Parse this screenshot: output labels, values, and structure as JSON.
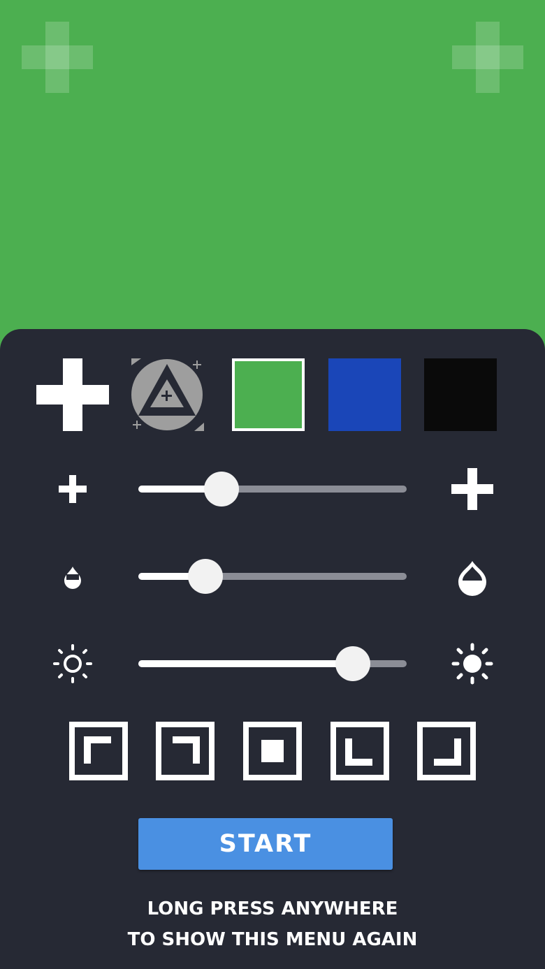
{
  "colors": {
    "background": "#4CAF50",
    "panel": "#262934",
    "accent": "#4A90E2",
    "track": "#8b8d96"
  },
  "background_icons": [
    "plus-icon",
    "plus-icon"
  ],
  "crosshair_options": [
    {
      "id": "plain-cross",
      "icon": "plus-icon",
      "selected": true
    },
    {
      "id": "triangle-circle",
      "icon": "triangle-circle-icon",
      "selected": false
    }
  ],
  "color_swatches": [
    {
      "color": "#4CAF50",
      "selected": true
    },
    {
      "color": "#1A46B8",
      "selected": false
    },
    {
      "color": "#0A0A0A",
      "selected": false
    }
  ],
  "sliders": [
    {
      "id": "size",
      "min_icon": "plus-small-icon",
      "max_icon": "plus-large-icon",
      "value": 0.31
    },
    {
      "id": "opacity",
      "min_icon": "drop-small-icon",
      "max_icon": "drop-large-icon",
      "value": 0.25
    },
    {
      "id": "brightness",
      "min_icon": "sun-dim-icon",
      "max_icon": "sun-bright-icon",
      "value": 0.8
    }
  ],
  "positions": [
    {
      "id": "top-left",
      "icon": "corner-top-left-icon",
      "selected": false
    },
    {
      "id": "top-right",
      "icon": "corner-top-right-icon",
      "selected": false
    },
    {
      "id": "center",
      "icon": "center-square-icon",
      "selected": true
    },
    {
      "id": "bottom-left",
      "icon": "corner-bottom-left-icon",
      "selected": false
    },
    {
      "id": "bottom-right",
      "icon": "corner-bottom-right-icon",
      "selected": false
    }
  ],
  "start_button": {
    "label": "START"
  },
  "hint": {
    "line1": "LONG PRESS ANYWHERE",
    "line2": "TO SHOW THIS MENU AGAIN"
  }
}
